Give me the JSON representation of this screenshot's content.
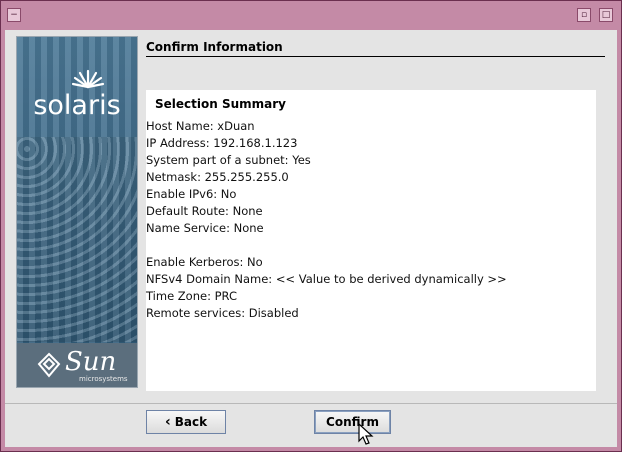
{
  "window": {
    "controls": {
      "menu_glyph": "−",
      "right_glyph_1": "▫",
      "right_glyph_2": "□"
    }
  },
  "header": {
    "title": "Confirm Information"
  },
  "sidebar": {
    "brand_top": "solaris",
    "brand_bottom": "Sun",
    "brand_bottom_sub": "microsystems"
  },
  "summary": {
    "title": "Selection Summary",
    "lines": [
      "Host Name: xDuan",
      "IP Address: 192.168.1.123",
      "System part of a subnet: Yes",
      "Netmask: 255.255.255.0",
      "Enable IPv6: No",
      "Default Route: None",
      "Name Service: None",
      "",
      "Enable Kerberos: No",
      "NFSv4 Domain Name: << Value to be derived dynamically >>",
      "Time Zone: PRC",
      "Remote services: Disabled"
    ]
  },
  "buttons": {
    "back_label": "Back",
    "confirm_label": "Confirm"
  },
  "colors": {
    "title_bar": "#c48aa6",
    "background": "#e4e4e4"
  }
}
